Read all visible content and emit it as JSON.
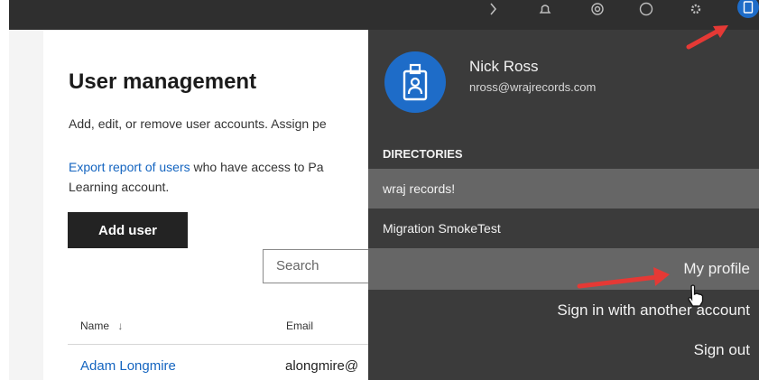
{
  "colors": {
    "topbar": "#2f2f2f",
    "flyout_bg": "#3b3b3b",
    "highlight": "#666666",
    "link": "#1565c0",
    "button": "#232323",
    "avatar": "#1e6cc8",
    "annotation_arrow": "#e53935"
  },
  "topbar": {
    "icons": [
      "chevron-icon",
      "bell-icon",
      "target-icon",
      "help-icon",
      "gear-icon",
      "account-icon"
    ]
  },
  "page": {
    "title": "User management",
    "description": "Add, edit, or remove user accounts. Assign pe",
    "export_link": "Export report of users",
    "export_rest": " who have access to Pa",
    "export_line2": "Learning account.",
    "add_user_label": "Add user",
    "search_placeholder": "Search",
    "table": {
      "columns": [
        {
          "label": "Name",
          "sort_icon": "sort-down-icon"
        },
        {
          "label": "Email"
        }
      ],
      "rows": [
        {
          "name": "Adam Longmire",
          "email": "alongmire@"
        }
      ]
    }
  },
  "account_menu": {
    "name": "Nick Ross",
    "email": "nross@wrajrecords.com",
    "avatar_icon": "id-badge-icon",
    "directories_heading": "DIRECTORIES",
    "directories": [
      {
        "label": "wraj records!",
        "selected": true
      },
      {
        "label": "Migration SmokeTest",
        "selected": false
      }
    ],
    "items": [
      {
        "label": "My profile"
      },
      {
        "label": "Sign in with another account"
      },
      {
        "label": "Sign out"
      }
    ]
  }
}
